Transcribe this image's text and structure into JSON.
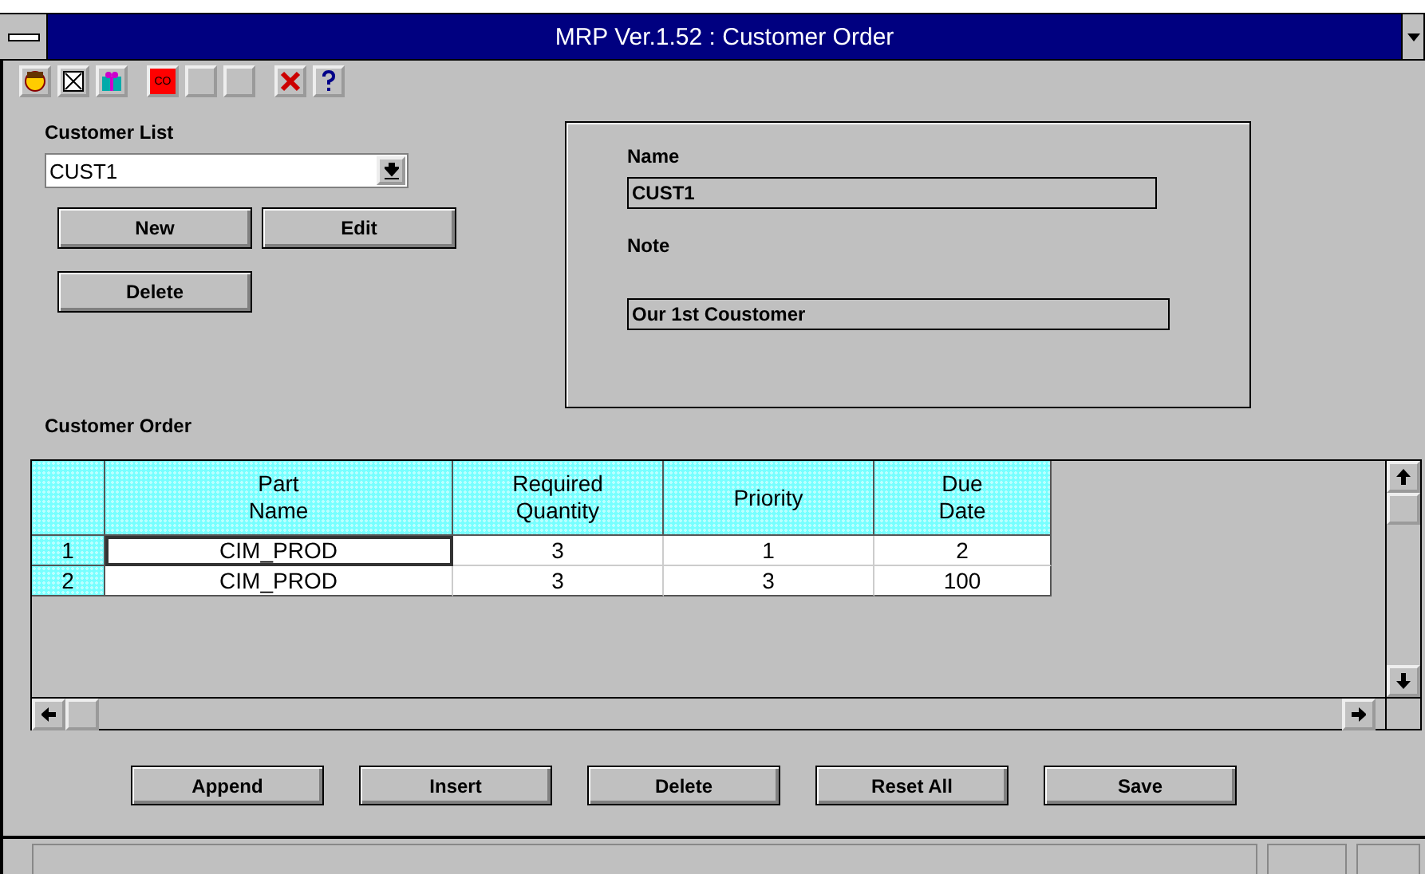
{
  "window": {
    "title": "MRP Ver.1.52 : Customer Order"
  },
  "toolbar": [
    {
      "kind": "icon"
    },
    {
      "kind": "icon"
    },
    {
      "kind": "icon"
    },
    {
      "kind": "text",
      "label": "CO"
    },
    {
      "kind": "blank"
    },
    {
      "kind": "blank"
    },
    {
      "kind": "icon"
    },
    {
      "kind": "icon"
    }
  ],
  "customer_list": {
    "label": "Customer List",
    "value": "CUST1"
  },
  "customer_buttons": [
    "New",
    "Edit",
    "Delete"
  ],
  "details": {
    "name_label": "Name",
    "name_value": "CUST1",
    "note_label": "Note",
    "note_value": "Our 1st Coustomer"
  },
  "order": {
    "label": "Customer Order",
    "columns": [
      "Part\nName",
      "Required\nQuantity",
      "Priority",
      "Due\nDate"
    ],
    "rows": [
      {
        "number": "1",
        "cells": [
          {
            "text": "CIM_PROD",
            "focused": true
          },
          {
            "text": "3",
            "focused": false
          },
          {
            "text": "1",
            "focused": false
          },
          {
            "text": "2",
            "focused": false
          }
        ]
      },
      {
        "number": "2",
        "cells": [
          {
            "text": "CIM_PROD",
            "focused": false
          },
          {
            "text": "3",
            "focused": false
          },
          {
            "text": "3",
            "focused": false
          },
          {
            "text": "100",
            "focused": false
          }
        ]
      }
    ]
  },
  "actions": [
    "Append",
    "Insert",
    "Delete",
    "Reset All",
    "Save"
  ]
}
